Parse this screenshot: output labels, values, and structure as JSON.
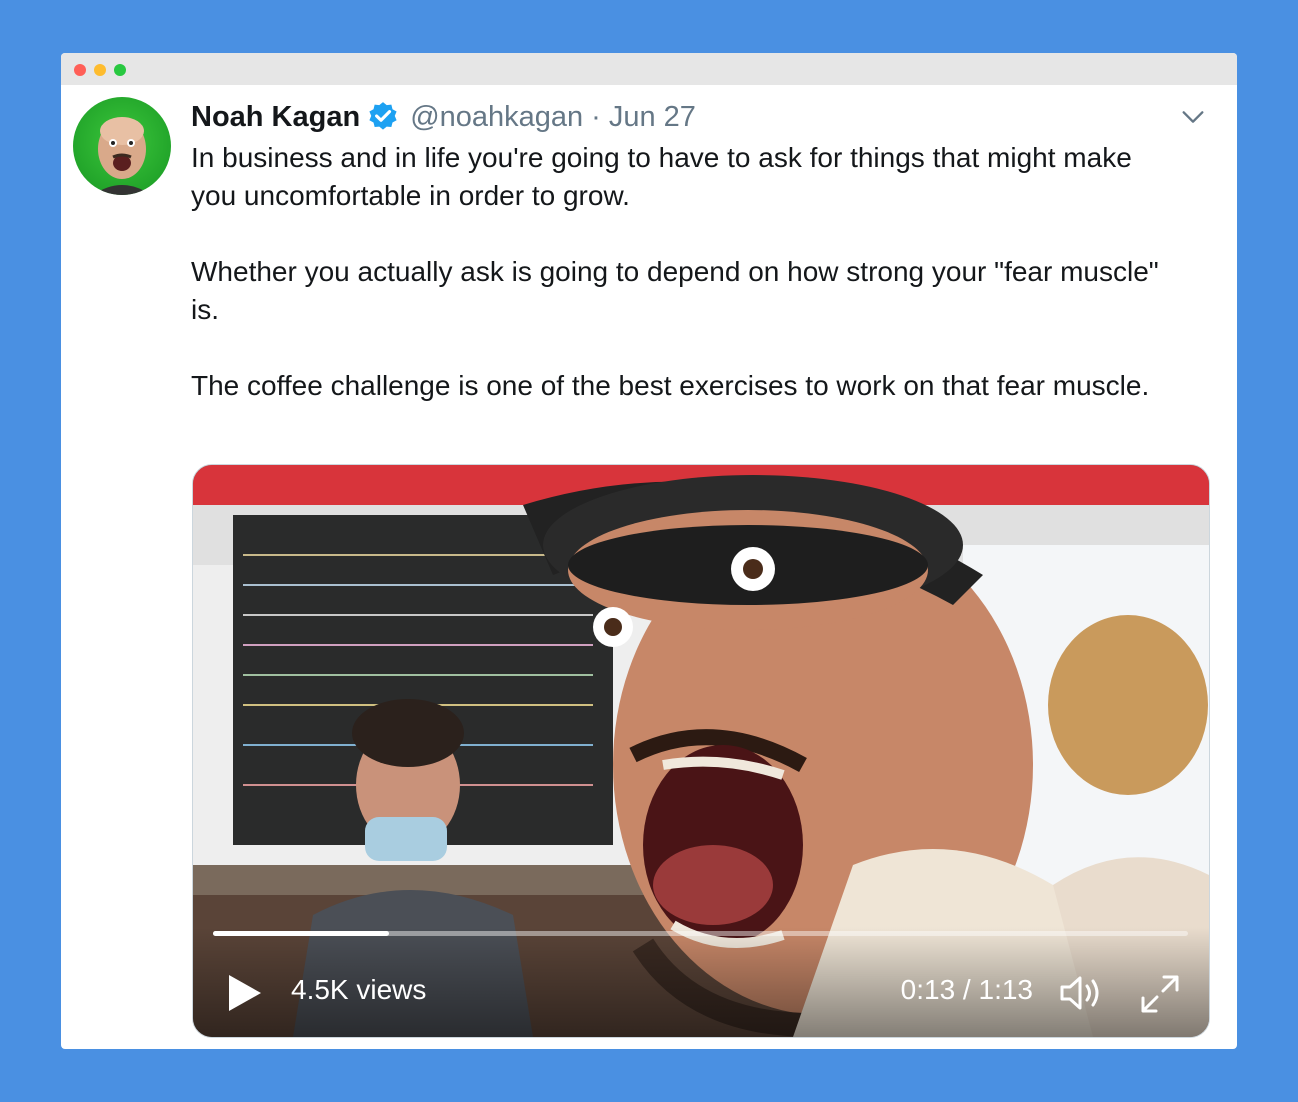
{
  "tweet": {
    "author_name": "Noah Kagan",
    "handle": "@noahkagan",
    "separator": "·",
    "date": "Jun 27",
    "paragraphs": [
      "In business and in life you're going to have to ask for things that might make you uncomfortable in order to grow.",
      "Whether you actually ask is going to depend on how strong your \"fear muscle\" is.",
      "The coffee challenge is one of the best exercises to work on that fear muscle."
    ]
  },
  "video": {
    "views": "4.5K views",
    "time": "0:13 / 1:13",
    "progress_fraction": 0.18
  },
  "icons": {
    "verified": "verified-badge-icon",
    "more": "chevron-down-icon",
    "play": "play-icon",
    "volume": "volume-icon",
    "fullscreen": "expand-icon"
  },
  "colors": {
    "background": "#4a90e2",
    "verified": "#1da1f2",
    "secondary_text": "#657786",
    "primary_text": "#14171a"
  }
}
